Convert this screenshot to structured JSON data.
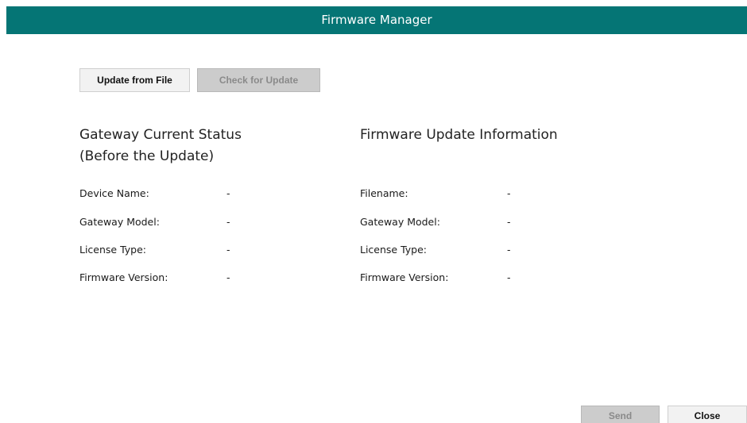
{
  "window": {
    "title": "Firmware Manager"
  },
  "toolbar": {
    "update_from_file_label": "Update from File",
    "check_for_update_label": "Check for Update"
  },
  "current_status": {
    "heading_line1": "Gateway Current Status",
    "heading_line2": "(Before the Update)",
    "rows": [
      {
        "label": "Device Name:",
        "value": "-"
      },
      {
        "label": "Gateway Model:",
        "value": "-"
      },
      {
        "label": "License Type:",
        "value": "-"
      },
      {
        "label": "Firmware Version:",
        "value": "-"
      }
    ]
  },
  "update_info": {
    "heading": "Firmware Update Information",
    "rows": [
      {
        "label": "Filename:",
        "value": "-"
      },
      {
        "label": "Gateway Model:",
        "value": "-"
      },
      {
        "label": "License Type:",
        "value": "-"
      },
      {
        "label": "Firmware Version:",
        "value": "-"
      }
    ]
  },
  "footer": {
    "send_label": "Send",
    "close_label": "Close"
  },
  "colors": {
    "titlebar": "#057575",
    "button_enabled": "#f2f2f2",
    "button_disabled": "#cccccc"
  }
}
